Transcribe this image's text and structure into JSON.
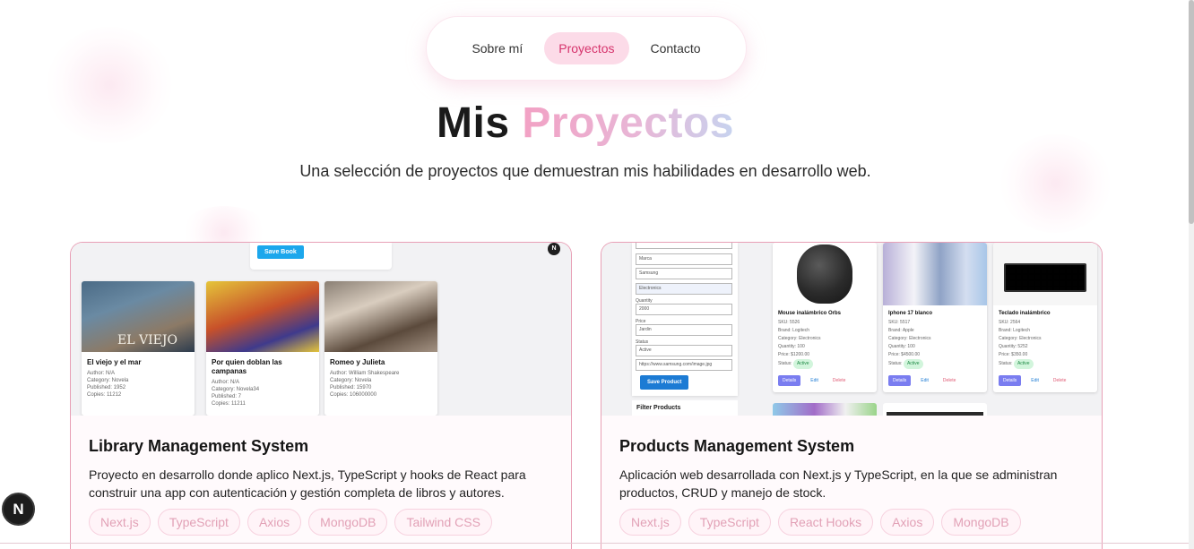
{
  "nav": {
    "items": [
      {
        "label": "Sobre mí",
        "active": false
      },
      {
        "label": "Proyectos",
        "active": true
      },
      {
        "label": "Contacto",
        "active": false
      }
    ]
  },
  "hero": {
    "title_plain": "Mis",
    "title_accent": "Proyectos",
    "subtitle": "Una selección de proyectos que demuestran mis habilidades en desarrollo web."
  },
  "projects": [
    {
      "title": "Library Management System",
      "description": "Proyecto en desarrollo donde aplico Next.js, TypeScript y hooks de React para construir una app con autenticación y gestión completa de libros y autores.",
      "tags": [
        "Next.js",
        "TypeScript",
        "Axios",
        "MongoDB",
        "Tailwind CSS"
      ],
      "screenshot": {
        "save_button": "Save Book",
        "badge": "N",
        "books": [
          {
            "title": "El viejo y el mar",
            "cover_text": "EL VIEJO",
            "meta": [
              "Author: N/A",
              "Category: Novela",
              "Published: 1952",
              "Copies: 11212"
            ]
          },
          {
            "title": "Por quien doblan las campanas",
            "cover_text": "",
            "meta": [
              "Author: N/A",
              "Category: Novela34",
              "Published: 7",
              "Copies: 11211"
            ]
          },
          {
            "title": "Romeo y Julieta",
            "cover_text": "",
            "meta": [
              "Author: William Shakespeare",
              "Category: Novela",
              "Published: 15970",
              "Copies: 106000000"
            ]
          }
        ]
      }
    },
    {
      "title": "Products Management System",
      "description": "Aplicación web desarrollada con Next.js y TypeScript, en la que se administran productos, CRUD y manejo de stock.",
      "tags": [
        "Next.js",
        "TypeScript",
        "React Hooks",
        "Axios",
        "MongoDB"
      ],
      "screenshot": {
        "form_values": [
          "Marca",
          "Samsung",
          "Electronics",
          "2000",
          "Jardin",
          "Active",
          "https://www.samsung.com/image.jpg"
        ],
        "form_labels": [
          "Quantity",
          "Price",
          "Status"
        ],
        "save_button": "Save Product",
        "filter_label": "Filter Products",
        "products": [
          {
            "name": "Mouse inalámbrico Orbs",
            "meta": [
              "SKU: 5526",
              "Brand: Logitech",
              "Category: Electronics",
              "Quantity: 100",
              "Price: $1200.00"
            ],
            "status": "Active"
          },
          {
            "name": "Iphone 17 blanco",
            "meta": [
              "SKU: 5517",
              "Brand: Apple",
              "Category: Electronics",
              "Quantity: 100",
              "Price: $4500.00"
            ],
            "status": "Active"
          },
          {
            "name": "Teclado inalámbrico",
            "meta": [
              "SKU: 2564",
              "Brand: Logitech",
              "Category: Electronics",
              "Quantity: 5252",
              "Price: $350.00"
            ],
            "status": "Active"
          }
        ],
        "actions": {
          "details": "Details",
          "edit": "Edit",
          "delete": "Delete"
        },
        "status_label": "Status:"
      }
    }
  ],
  "floating_badge": "N",
  "colors": {
    "accent_pink": "#d6336c",
    "nav_active_bg": "#fcdbe8",
    "card_border": "#e8a0b6",
    "tag_text": "#e2a1b6"
  }
}
